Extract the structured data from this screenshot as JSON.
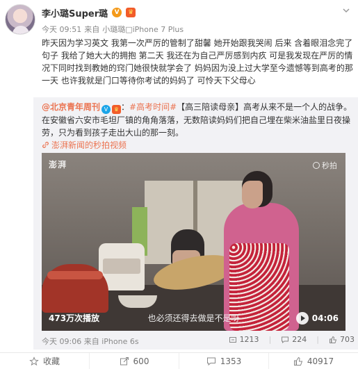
{
  "post": {
    "user_name": "李小璐Super璐",
    "badge_v": "V",
    "time": "今天 09:51",
    "from_label": "来自",
    "source": "小璐璐□iPhone 7 Plus",
    "text": "昨天因为学习英文 我第一次严厉的管制了甜馨 她开始跟我哭闹 后来 含着眼泪念完了句子 我给了她大大的拥抱 第二天 我还在为自己严厉感到内疚 可是我发现在严厉的情况下同时找到教她的窍门她很快就学会了 妈妈因为没上过大学至今遗憾等到高考的那一天 也许我就是门口等待你考试的妈妈了 可怜天下父母心"
  },
  "repost": {
    "at_name": "@北京青年周刊",
    "hashtag": "#高考时间#",
    "text": "【高三陪读母亲】高考从来不是一个人的战争。在安徽省六安市毛坦厂镇的角角落落，无数陪读妈妈们把自己埋在柴米油盐里日夜操劳，只为看到孩子走出大山的那一刻。",
    "link_text": "澎湃新闻的秒拍视频",
    "video": {
      "logo": "澎湃",
      "watermark": "秒拍",
      "plays": "473万次播放",
      "caption": "也必须还得去做是不是呀",
      "duration": "04:06"
    },
    "time": "今天 09:06",
    "from_label": "来自",
    "source": "iPhone 6s",
    "reposts": "1213",
    "comments": "224",
    "likes": "703"
  },
  "actions": {
    "favorite_label": "收藏",
    "repost_count": "600",
    "comment_count": "1353",
    "like_count": "40917"
  },
  "colors": {
    "accent": "#eb7350",
    "repost_bg": "#f2f2f5"
  }
}
